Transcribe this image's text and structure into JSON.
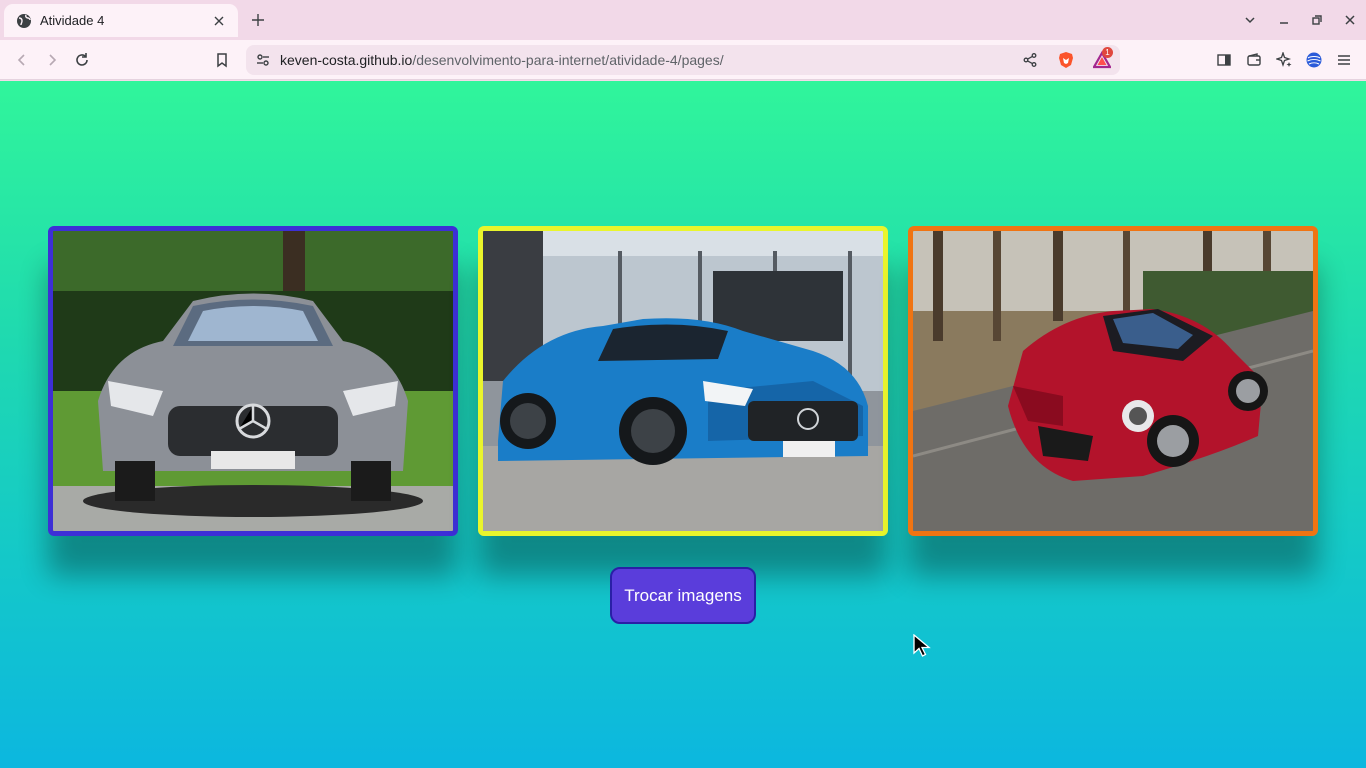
{
  "browser": {
    "tab": {
      "title": "Atividade 4",
      "favicon": "globe-icon"
    },
    "url": {
      "host": "keven-costa.github.io",
      "path": "/desenvolvimento-para-internet/atividade-4/pages/"
    },
    "rewards_badge": "1",
    "icons": [
      "back-icon",
      "forward-icon",
      "reload-icon",
      "bookmark-icon",
      "site-info-icon",
      "share-icon",
      "brave-shields-icon",
      "brave-rewards-icon",
      "sidebar-icon",
      "wallet-icon",
      "leo-ai-icon",
      "vpn-icon",
      "menu-icon",
      "tab-search-icon",
      "minimize-icon",
      "maximize-icon",
      "close-icon"
    ]
  },
  "page": {
    "background": {
      "top": "#30f59b",
      "bottom": "#0cb7df"
    },
    "cards": [
      {
        "subject": "silver Mercedes-AMG GT front view",
        "border_color": "#3d2fd6"
      },
      {
        "subject": "blue Mercedes-AMG GT R",
        "border_color": "#e9f52c"
      },
      {
        "subject": "red Alfa Romeo 4C on road",
        "border_color": "#f07412"
      }
    ],
    "swap_button": {
      "label": "Trocar imagens",
      "color": "#5a3ddb"
    }
  }
}
